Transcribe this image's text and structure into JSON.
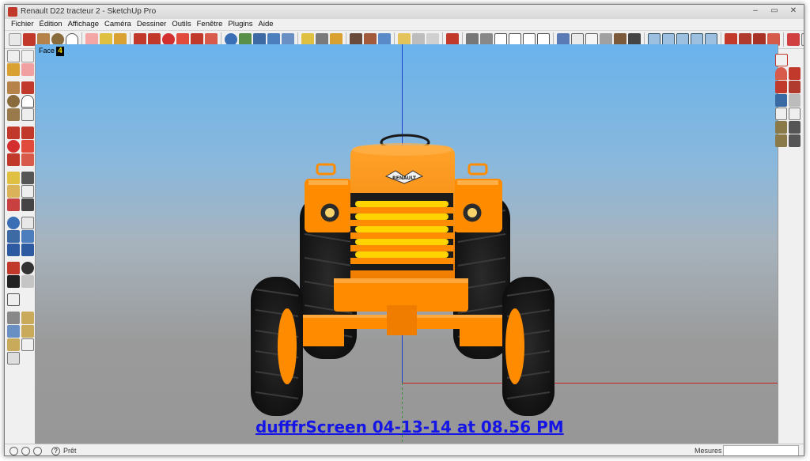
{
  "window": {
    "title": "Renault D22 tracteur 2 - SketchUp Pro",
    "controls": [
      "–",
      "▭",
      "✕"
    ]
  },
  "menu": [
    "Fichier",
    "Édition",
    "Affichage",
    "Caméra",
    "Dessiner",
    "Outils",
    "Fenêtre",
    "Plugins",
    "Aide"
  ],
  "viewport": {
    "scene_label": "Face",
    "scene_number": "4",
    "emblem_text": "RENAULT",
    "caption": "dufffrScreen 04-13-14 at 08.56 PM"
  },
  "statusbar": {
    "status_text": "Prêt",
    "measure_label": "Mesures",
    "measure_value": ""
  },
  "colors": {
    "sky_top": "#6ab3ec",
    "ground": "#979797",
    "tractor_orange": "#ff8c00",
    "blue_axis": "#1d3fc9",
    "red_axis": "#c8221c",
    "caption_link": "#1515e6"
  }
}
